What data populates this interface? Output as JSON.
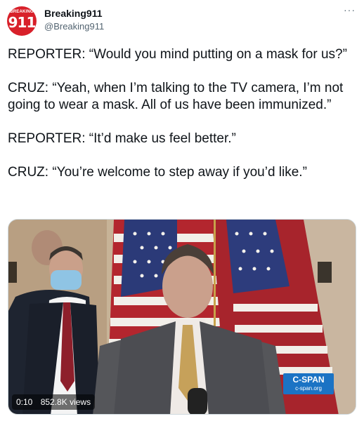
{
  "author": {
    "name": "Breaking911",
    "handle": "@Breaking911",
    "avatar_top": "BREAKING",
    "avatar_number": "911"
  },
  "menu": {
    "icon": "more-icon",
    "glyph": "···"
  },
  "tweet": {
    "lines": [
      "REPORTER: “Would you mind putting on a mask for us?”",
      "CRUZ: “Yeah, when I’m talking to the TV camera, I’m not going to wear a mask. All of us have been immunized.”",
      "REPORTER: “It’d make us feel better.”",
      "CRUZ: “You’re welcome to step away if you’d like.”"
    ]
  },
  "video": {
    "elapsed": "0:10",
    "views": "852.8K views",
    "watermark_title": "C-SPAN",
    "watermark_url": "c-span.org"
  },
  "colors": {
    "brand_red": "#d8202a",
    "cspan_blue": "#1b73c4",
    "muted": "#536471"
  }
}
